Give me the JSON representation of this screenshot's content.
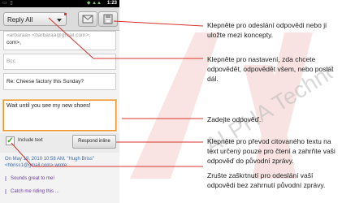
{
  "status_bar": {
    "time": "1:23"
  },
  "toolbar": {
    "reply_mode": "Reply All",
    "send_icon": "send-icon",
    "save_icon": "save-icon"
  },
  "compose": {
    "to_faded": "«arbaraa» <barbaraa@gmail.com>,",
    "to_value": "com>,",
    "bcc_placeholder": "Bcc",
    "subject": "Re: Cheese factory this Sunday?",
    "body": "Wait until you see my new shoes!"
  },
  "quote": {
    "include_label": "Include text",
    "respond_inline_label": "Respond inline",
    "header": "On May 19, 2010 10:58 AM, \"Hugh Briss\" <hbriss1@gmail.com> wrote:",
    "lines": [
      "Sounds great to me!",
      "Catch me riding this ..."
    ]
  },
  "callouts": [
    "Klepněte pro odeslání odpovědi nebo ji uložte mezi koncepty.",
    "Klepněte pro nastavení, zda chcete odpovědět, odpovědět všem, nebo poslat dál.",
    "Zadejte odpověď.",
    "Klepněte pro převod citovaného textu na text určený pouze pro čtení a zahrňte vaši odpověď do původní zprávy.",
    "Zrušte zaškrtnutí pro odeslání vaší odpovědi bez zahrnutí původní zprávy."
  ],
  "watermark": {
    "text": "ALPHA Technology"
  },
  "colors": {
    "accent_orange": "#f0922a",
    "check_green": "#3aa42b",
    "link_blue": "#3b6bb3",
    "quote_purple": "#6a3ca0",
    "callout_line": "#d8322a"
  }
}
